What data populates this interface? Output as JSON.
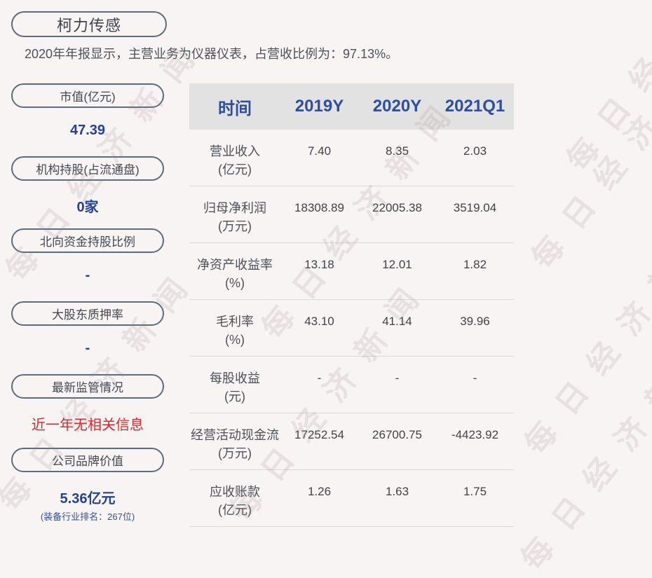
{
  "branding": {
    "watermark": "每日经济新闻"
  },
  "header": {
    "company_name": "柯力传感",
    "description": "2020年年报显示，主营业务为仪器仪表，占营收比例为：97.13%。"
  },
  "sidebar": {
    "stats": [
      {
        "label": "市值(亿元)",
        "value": "47.39"
      },
      {
        "label": "机构持股(占流通盘)",
        "value": "0家"
      },
      {
        "label": "北向资金持股比例",
        "value": "-"
      },
      {
        "label": "大股东质押率",
        "value": "-"
      },
      {
        "label": "最新监管情况",
        "value": "近一年无相关信息"
      },
      {
        "label": "公司品牌价值",
        "value": "5.36亿元",
        "sub_value": "(装备行业排名：267位)"
      }
    ]
  },
  "chart_data": {
    "type": "table",
    "columns": [
      "时间",
      "2019Y",
      "2020Y",
      "2021Q1"
    ],
    "rows": [
      {
        "indicator": "营业收入",
        "unit": "(亿元)",
        "values": [
          "7.40",
          "8.35",
          "2.03"
        ]
      },
      {
        "indicator": "归母净利润",
        "unit": "(万元)",
        "values": [
          "18308.89",
          "22005.38",
          "3519.04"
        ]
      },
      {
        "indicator": "净资产收益率",
        "unit": "(%)",
        "values": [
          "13.18",
          "12.01",
          "1.82"
        ]
      },
      {
        "indicator": "毛利率",
        "unit": "(%)",
        "values": [
          "43.10",
          "41.14",
          "39.96"
        ]
      },
      {
        "indicator": "每股收益",
        "unit": "(元)",
        "values": [
          "-",
          "-",
          "-"
        ]
      },
      {
        "indicator": "经营活动现金流",
        "unit": "(万元)",
        "values": [
          "17252.54",
          "26700.75",
          "-4423.92"
        ]
      },
      {
        "indicator": "应收账款",
        "unit": "(亿元)",
        "values": [
          "1.26",
          "1.63",
          "1.75"
        ]
      }
    ]
  },
  "colors": {
    "background": "#f9f4f4",
    "accent_blue": "#2c4da2",
    "value_blue": "#24419b",
    "alert_red": "#e02727",
    "pill_border": "#5c6c7b",
    "table_header_bg": "#e3e2e2"
  }
}
